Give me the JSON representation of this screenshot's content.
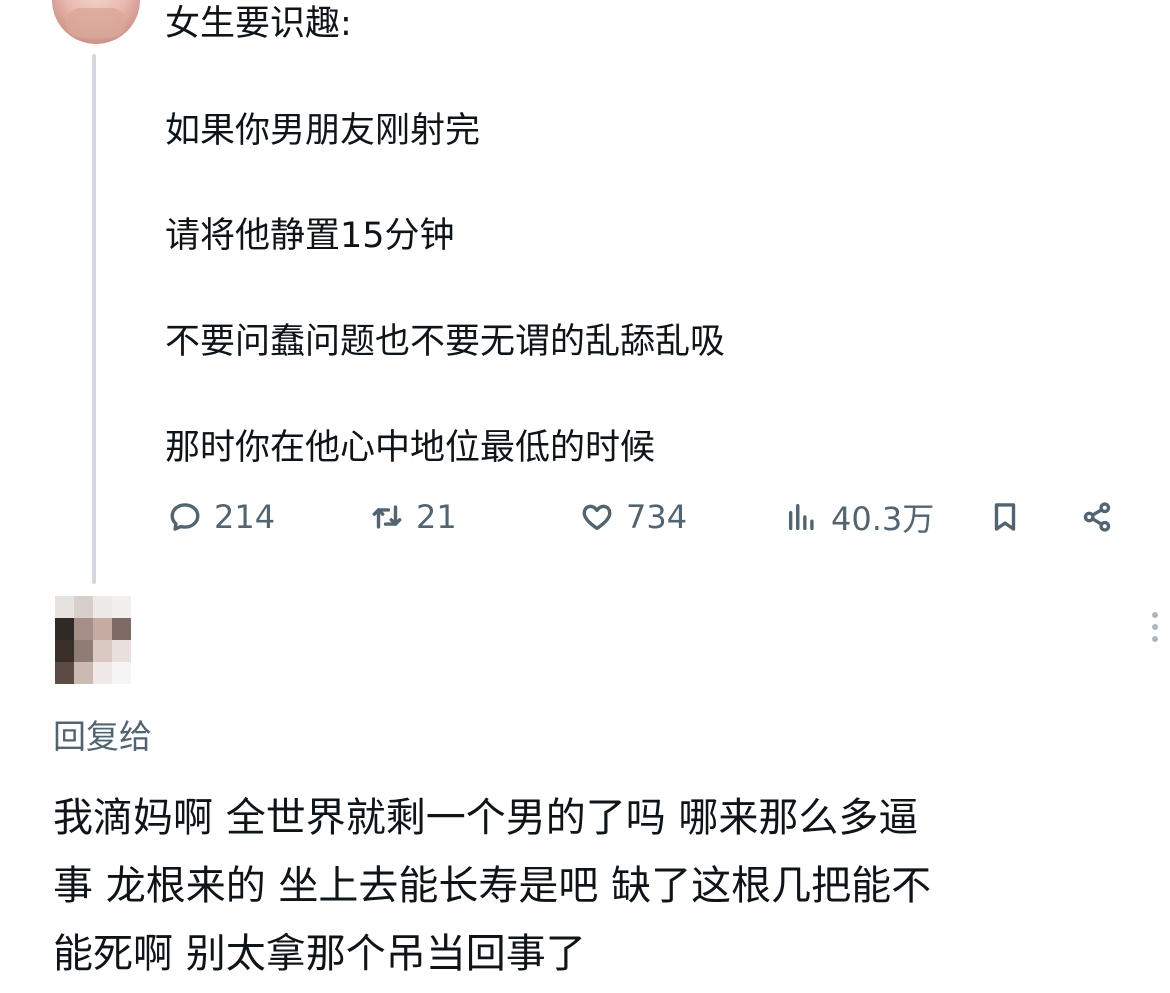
{
  "post": {
    "lines": [
      "女生要识趣:",
      "如果你男朋友刚射完",
      "请将他静置15分钟",
      "不要问蠢问题也不要无谓的乱舔乱吸",
      "那时你在他心中地位最低的时候"
    ],
    "stats": {
      "replies": "214",
      "reposts": "21",
      "likes": "734",
      "views": "40.3万"
    }
  },
  "reply": {
    "reply_to_label": "回复给",
    "text_lines": [
      "我滴妈啊 全世界就剩一个男的了吗 哪来那么多逼",
      "事 龙根来的 坐上去能长寿是吧 缺了这根几把能不",
      "能死啊 别太拿那个吊当回事了"
    ]
  },
  "icons": {
    "reply": "comment-bubble-icon",
    "repost": "repost-icon",
    "like": "heart-icon",
    "views": "views-bar-chart-icon",
    "bookmark": "bookmark-icon",
    "share": "share-icon",
    "more": "more-vertical-icon"
  },
  "colors": {
    "text": "#0f1419",
    "secondary": "#536471",
    "thread_line": "#cfd9de"
  }
}
